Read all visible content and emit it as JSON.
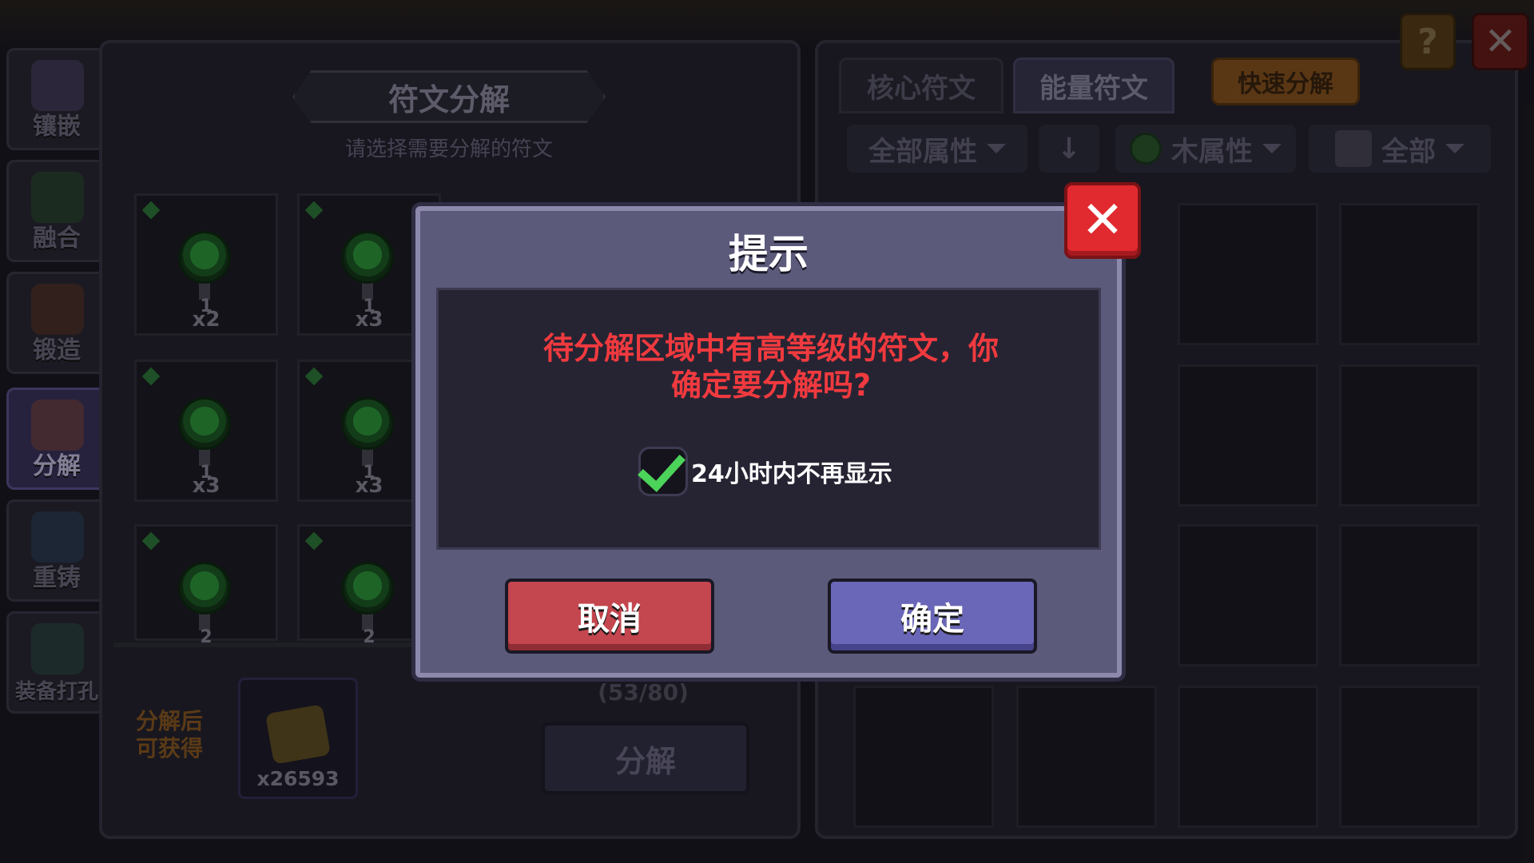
{
  "nav": {
    "items": [
      {
        "label": "镶嵌",
        "icon": "inlay-icon"
      },
      {
        "label": "融合",
        "icon": "fusion-icon"
      },
      {
        "label": "锻造",
        "icon": "forge-icon"
      },
      {
        "label": "分解",
        "icon": "decompose-icon",
        "active": true
      },
      {
        "label": "重铸",
        "icon": "recast-icon"
      },
      {
        "label": "装备打孔",
        "icon": "socket-icon"
      }
    ]
  },
  "left_panel": {
    "title": "符文分解",
    "subtitle": "请选择需要分解的符文",
    "slots": [
      {
        "level": "1",
        "count": "x2"
      },
      {
        "level": "1",
        "count": "x3"
      },
      {
        "level": "1",
        "count": "x3"
      },
      {
        "level": "1",
        "count": "x3"
      },
      {
        "level": "2",
        "count": ""
      },
      {
        "level": "2",
        "count": ""
      }
    ],
    "reward_label": "分解后可获得",
    "reward_count": "x26593",
    "capacity": "(53/80)",
    "decompose_button": "分解"
  },
  "right_panel": {
    "tabs": [
      "核心符文",
      "能量符文"
    ],
    "active_tab": "能量符文",
    "quick_button": "快速分解",
    "filters": {
      "attribute": "全部属性",
      "element": "木属性",
      "type": "全部"
    }
  },
  "top_buttons": {
    "help": "?",
    "close": "✕"
  },
  "modal": {
    "title": "提示",
    "message_line1": "待分解区域中有高等级的符文，你",
    "message_line2": "确定要分解吗?",
    "checkbox_label": "24小时内不再显示",
    "checkbox_checked": true,
    "cancel": "取消",
    "confirm": "确定",
    "close": "✕"
  },
  "colors": {
    "message_red": "#f03a3f",
    "cancel_red": "#c4464e",
    "confirm_purple": "#6a66b8",
    "check_green": "#4cd35a",
    "close_red": "#e02a2f"
  }
}
